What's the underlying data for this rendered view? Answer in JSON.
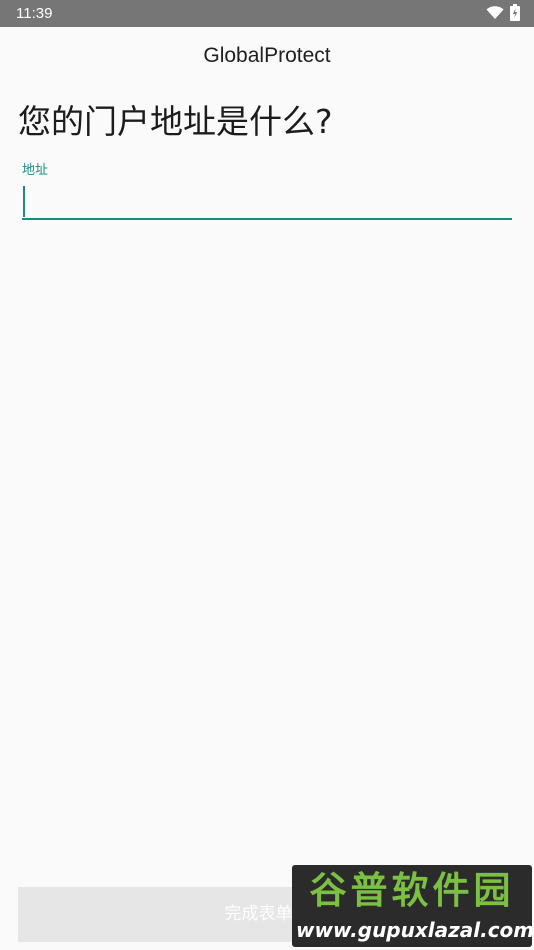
{
  "status_bar": {
    "time": "11:39",
    "icons": [
      "wifi-icon",
      "battery-charging-icon"
    ]
  },
  "app": {
    "title": "GlobalProtect"
  },
  "form": {
    "question": "您的门户地址是什么?",
    "address_label": "地址",
    "address_value": ""
  },
  "footer": {
    "submit_label": "完成表单以"
  },
  "watermark": {
    "title": "谷普软件园",
    "url": "www.gupuxlazal.com"
  },
  "colors": {
    "accent": "#198c80",
    "status_bar": "#767676",
    "background": "#fafafa",
    "button_disabled": "#e6e6e6",
    "watermark_green": "#7bc043"
  }
}
